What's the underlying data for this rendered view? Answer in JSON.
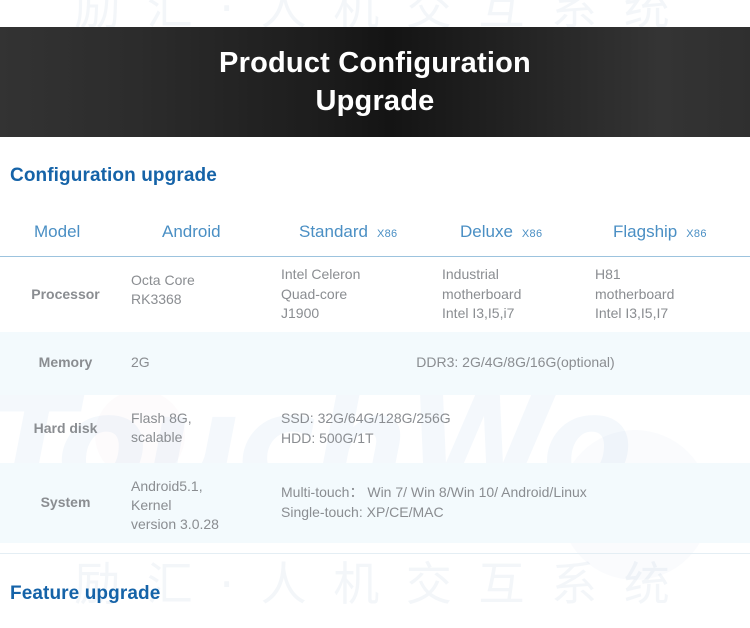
{
  "hero": {
    "title_line1": "Product Configuration",
    "title_line2": "Upgrade"
  },
  "sections": {
    "configuration_heading": "Configuration upgrade",
    "feature_heading": "Feature upgrade"
  },
  "watermark": {
    "brand": "TouchWo",
    "chinese_top": "励 汇 · 人 机 交 互 系 统",
    "chinese_bottom": "励 汇 · 人 机 交 互 系 统"
  },
  "table": {
    "headers": [
      {
        "label": "Model",
        "sup": ""
      },
      {
        "label": "Android",
        "sup": ""
      },
      {
        "label": "Standard",
        "sup": "X86"
      },
      {
        "label": "Deluxe",
        "sup": "X86"
      },
      {
        "label": "Flagship",
        "sup": "X86"
      }
    ],
    "rows": [
      {
        "label": "Processor",
        "android": "Octa Core\nRK3368",
        "android_l1": "Octa Core",
        "android_l2": "RK3368",
        "standard_l1": "Intel Celeron",
        "standard_l2": "Quad-core",
        "standard_l3": "J1900",
        "deluxe_l1": "Industrial",
        "deluxe_l2": "motherboard",
        "deluxe_l3": "Intel I3,I5,i7",
        "flagship_l1": "H81",
        "flagship_l2": "motherboard",
        "flagship_l3": "Intel I3,I5,I7"
      },
      {
        "label": "Memory",
        "android_l1": "2G",
        "merged": "DDR3: 2G/4G/8G/16G(optional)"
      },
      {
        "label": "Hard disk",
        "android_l1": "Flash 8G,",
        "android_l2": "scalable",
        "merged_l1": "SSD: 32G/64G/128G/256G",
        "merged_l2": "HDD: 500G/1T"
      },
      {
        "label": "System",
        "android_l1": "Android5.1,",
        "android_l2": "Kernel",
        "android_l3": "version 3.0.28",
        "merged_l1": "Multi-touch： Win 7/ Win 8/Win 10/ Android/Linux",
        "merged_l2": "Single-touch: XP/CE/MAC"
      }
    ]
  },
  "colors": {
    "heading_blue": "#1563a8",
    "header_blue": "#4a8fc4",
    "row_shade": "#f3fafd",
    "body_text": "#8a8d91",
    "label_text": "#3a3d42",
    "banner_dark": "#1d1d1d"
  }
}
